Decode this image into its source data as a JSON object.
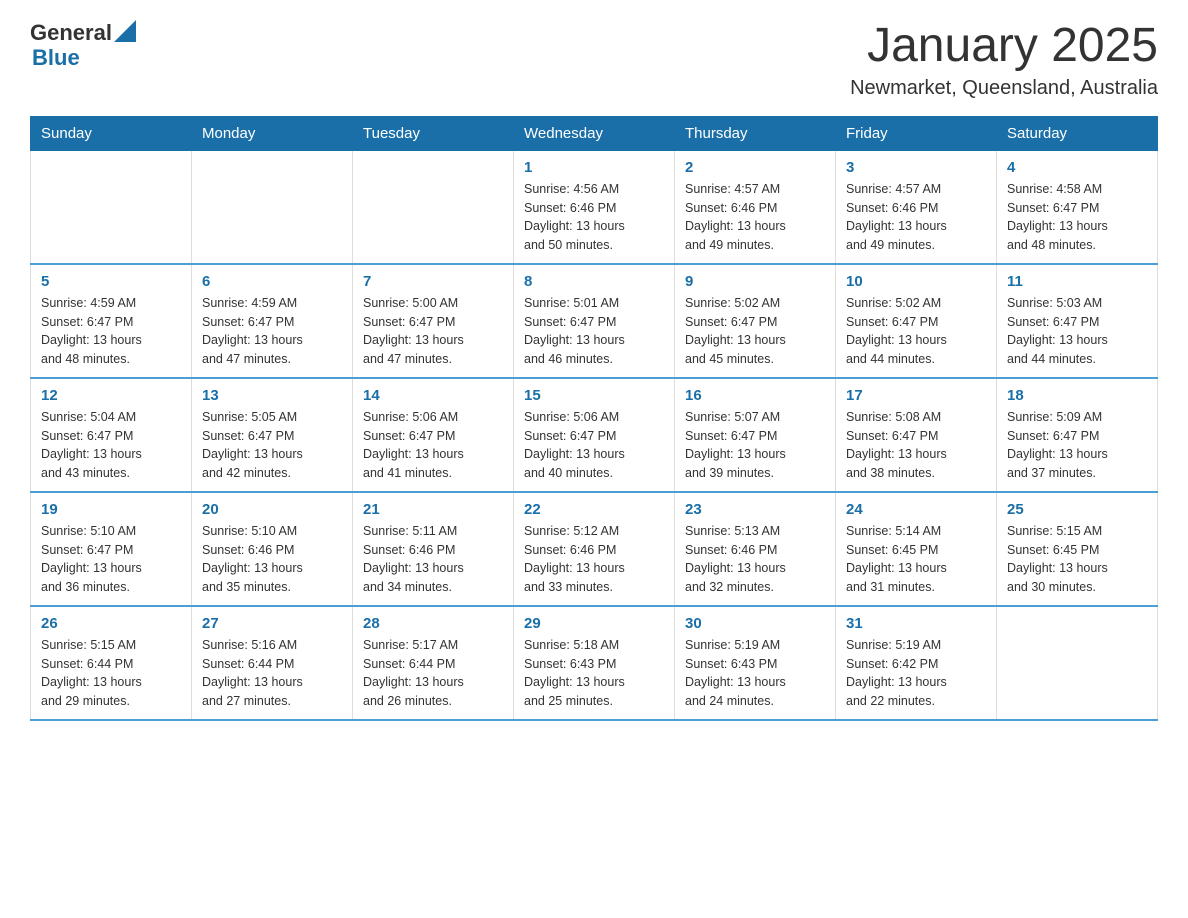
{
  "header": {
    "logo_general": "General",
    "logo_blue": "Blue",
    "title": "January 2025",
    "subtitle": "Newmarket, Queensland, Australia"
  },
  "days_of_week": [
    "Sunday",
    "Monday",
    "Tuesday",
    "Wednesday",
    "Thursday",
    "Friday",
    "Saturday"
  ],
  "weeks": [
    [
      {
        "day": "",
        "info": ""
      },
      {
        "day": "",
        "info": ""
      },
      {
        "day": "",
        "info": ""
      },
      {
        "day": "1",
        "info": "Sunrise: 4:56 AM\nSunset: 6:46 PM\nDaylight: 13 hours\nand 50 minutes."
      },
      {
        "day": "2",
        "info": "Sunrise: 4:57 AM\nSunset: 6:46 PM\nDaylight: 13 hours\nand 49 minutes."
      },
      {
        "day": "3",
        "info": "Sunrise: 4:57 AM\nSunset: 6:46 PM\nDaylight: 13 hours\nand 49 minutes."
      },
      {
        "day": "4",
        "info": "Sunrise: 4:58 AM\nSunset: 6:47 PM\nDaylight: 13 hours\nand 48 minutes."
      }
    ],
    [
      {
        "day": "5",
        "info": "Sunrise: 4:59 AM\nSunset: 6:47 PM\nDaylight: 13 hours\nand 48 minutes."
      },
      {
        "day": "6",
        "info": "Sunrise: 4:59 AM\nSunset: 6:47 PM\nDaylight: 13 hours\nand 47 minutes."
      },
      {
        "day": "7",
        "info": "Sunrise: 5:00 AM\nSunset: 6:47 PM\nDaylight: 13 hours\nand 47 minutes."
      },
      {
        "day": "8",
        "info": "Sunrise: 5:01 AM\nSunset: 6:47 PM\nDaylight: 13 hours\nand 46 minutes."
      },
      {
        "day": "9",
        "info": "Sunrise: 5:02 AM\nSunset: 6:47 PM\nDaylight: 13 hours\nand 45 minutes."
      },
      {
        "day": "10",
        "info": "Sunrise: 5:02 AM\nSunset: 6:47 PM\nDaylight: 13 hours\nand 44 minutes."
      },
      {
        "day": "11",
        "info": "Sunrise: 5:03 AM\nSunset: 6:47 PM\nDaylight: 13 hours\nand 44 minutes."
      }
    ],
    [
      {
        "day": "12",
        "info": "Sunrise: 5:04 AM\nSunset: 6:47 PM\nDaylight: 13 hours\nand 43 minutes."
      },
      {
        "day": "13",
        "info": "Sunrise: 5:05 AM\nSunset: 6:47 PM\nDaylight: 13 hours\nand 42 minutes."
      },
      {
        "day": "14",
        "info": "Sunrise: 5:06 AM\nSunset: 6:47 PM\nDaylight: 13 hours\nand 41 minutes."
      },
      {
        "day": "15",
        "info": "Sunrise: 5:06 AM\nSunset: 6:47 PM\nDaylight: 13 hours\nand 40 minutes."
      },
      {
        "day": "16",
        "info": "Sunrise: 5:07 AM\nSunset: 6:47 PM\nDaylight: 13 hours\nand 39 minutes."
      },
      {
        "day": "17",
        "info": "Sunrise: 5:08 AM\nSunset: 6:47 PM\nDaylight: 13 hours\nand 38 minutes."
      },
      {
        "day": "18",
        "info": "Sunrise: 5:09 AM\nSunset: 6:47 PM\nDaylight: 13 hours\nand 37 minutes."
      }
    ],
    [
      {
        "day": "19",
        "info": "Sunrise: 5:10 AM\nSunset: 6:47 PM\nDaylight: 13 hours\nand 36 minutes."
      },
      {
        "day": "20",
        "info": "Sunrise: 5:10 AM\nSunset: 6:46 PM\nDaylight: 13 hours\nand 35 minutes."
      },
      {
        "day": "21",
        "info": "Sunrise: 5:11 AM\nSunset: 6:46 PM\nDaylight: 13 hours\nand 34 minutes."
      },
      {
        "day": "22",
        "info": "Sunrise: 5:12 AM\nSunset: 6:46 PM\nDaylight: 13 hours\nand 33 minutes."
      },
      {
        "day": "23",
        "info": "Sunrise: 5:13 AM\nSunset: 6:46 PM\nDaylight: 13 hours\nand 32 minutes."
      },
      {
        "day": "24",
        "info": "Sunrise: 5:14 AM\nSunset: 6:45 PM\nDaylight: 13 hours\nand 31 minutes."
      },
      {
        "day": "25",
        "info": "Sunrise: 5:15 AM\nSunset: 6:45 PM\nDaylight: 13 hours\nand 30 minutes."
      }
    ],
    [
      {
        "day": "26",
        "info": "Sunrise: 5:15 AM\nSunset: 6:44 PM\nDaylight: 13 hours\nand 29 minutes."
      },
      {
        "day": "27",
        "info": "Sunrise: 5:16 AM\nSunset: 6:44 PM\nDaylight: 13 hours\nand 27 minutes."
      },
      {
        "day": "28",
        "info": "Sunrise: 5:17 AM\nSunset: 6:44 PM\nDaylight: 13 hours\nand 26 minutes."
      },
      {
        "day": "29",
        "info": "Sunrise: 5:18 AM\nSunset: 6:43 PM\nDaylight: 13 hours\nand 25 minutes."
      },
      {
        "day": "30",
        "info": "Sunrise: 5:19 AM\nSunset: 6:43 PM\nDaylight: 13 hours\nand 24 minutes."
      },
      {
        "day": "31",
        "info": "Sunrise: 5:19 AM\nSunset: 6:42 PM\nDaylight: 13 hours\nand 22 minutes."
      },
      {
        "day": "",
        "info": ""
      }
    ]
  ]
}
